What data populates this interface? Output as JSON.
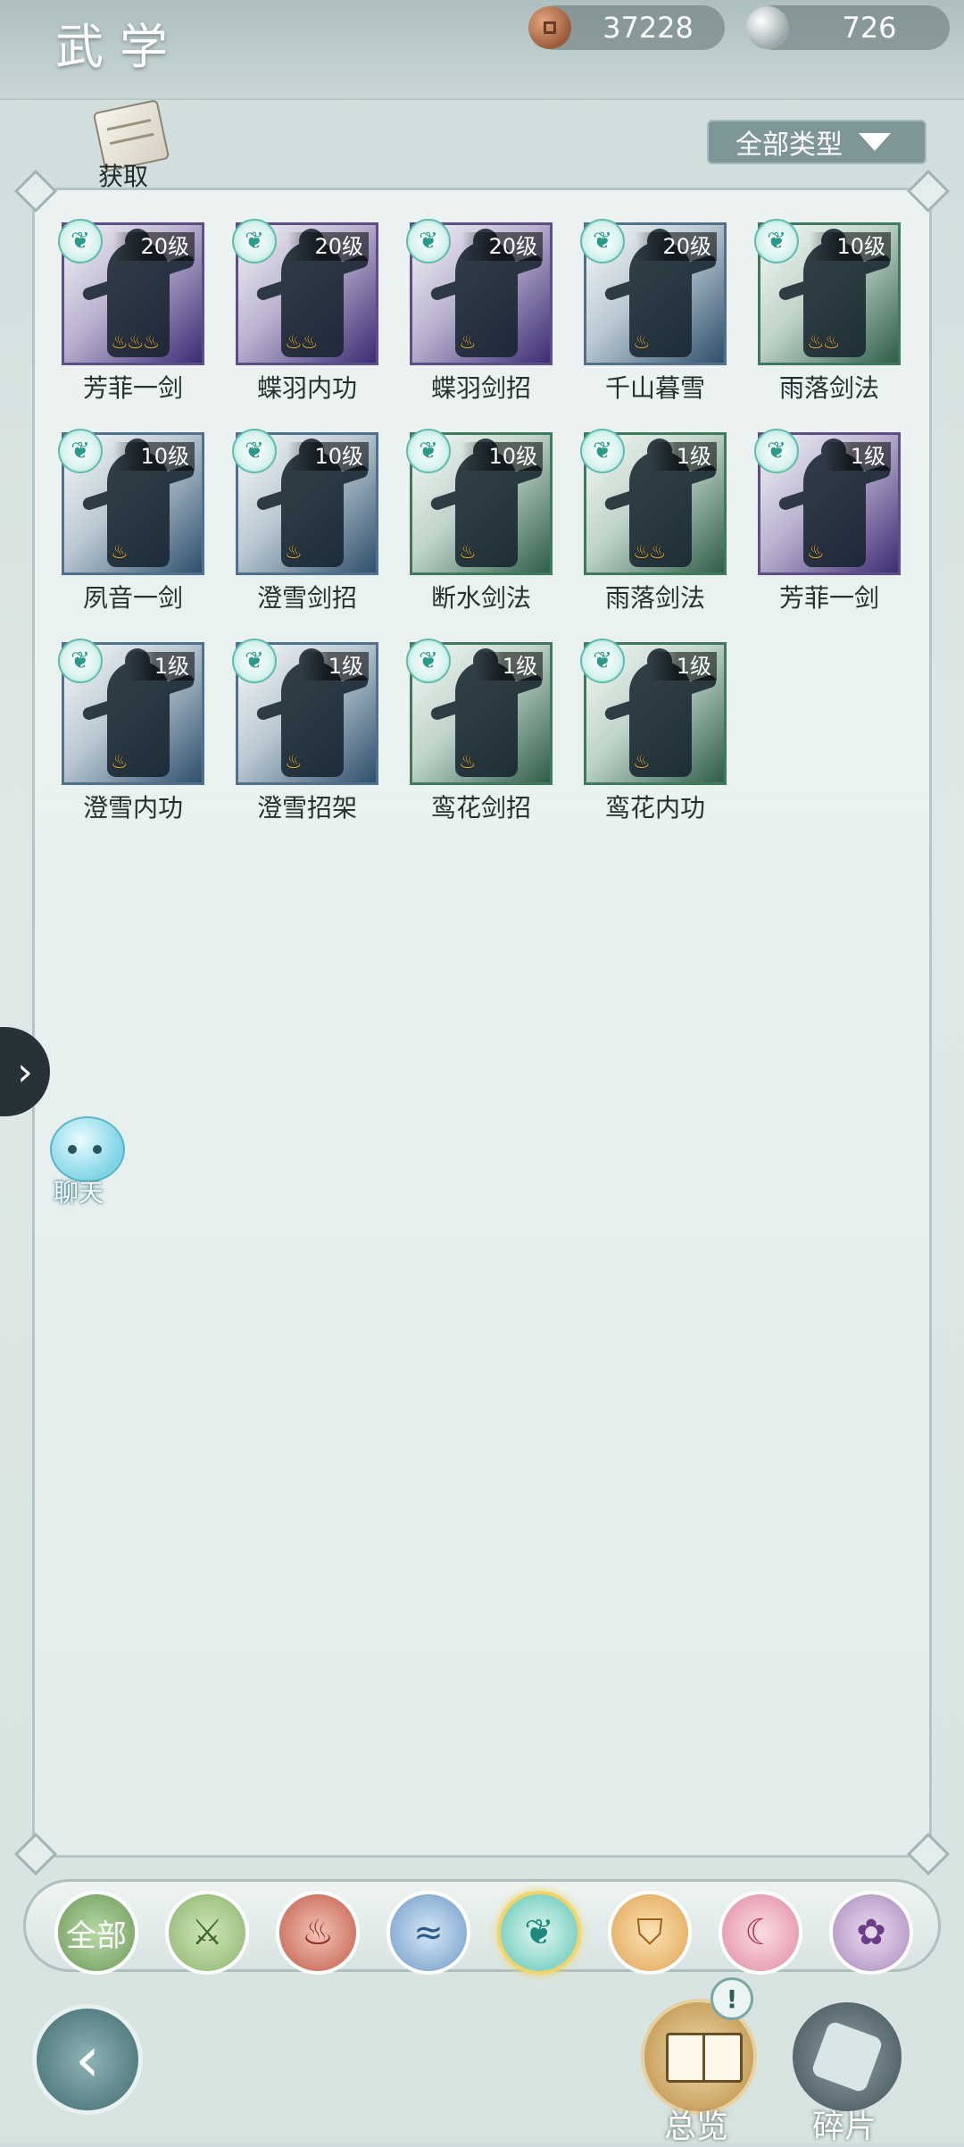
{
  "header": {
    "title": "武学",
    "coins": "37228",
    "silver": "726"
  },
  "toolbar": {
    "obtain_label": "获取",
    "type_filter": "全部类型"
  },
  "skills": [
    {
      "name": "芳菲一剑",
      "level": "20级",
      "theme": "purple",
      "stars": 3
    },
    {
      "name": "蝶羽内功",
      "level": "20级",
      "theme": "purple",
      "stars": 2
    },
    {
      "name": "蝶羽剑招",
      "level": "20级",
      "theme": "purple",
      "stars": 1
    },
    {
      "name": "千山暮雪",
      "level": "20级",
      "theme": "blue",
      "stars": 1
    },
    {
      "name": "雨落剑法",
      "level": "10级",
      "theme": "green",
      "stars": 2
    },
    {
      "name": "夙音一剑",
      "level": "10级",
      "theme": "blue",
      "stars": 1
    },
    {
      "name": "澄雪剑招",
      "level": "10级",
      "theme": "blue",
      "stars": 1
    },
    {
      "name": "断水剑法",
      "level": "10级",
      "theme": "green",
      "stars": 1
    },
    {
      "name": "雨落剑法",
      "level": "1级",
      "theme": "green",
      "stars": 2
    },
    {
      "name": "芳菲一剑",
      "level": "1级",
      "theme": "purple",
      "stars": 1
    },
    {
      "name": "澄雪内功",
      "level": "1级",
      "theme": "blue",
      "stars": 1
    },
    {
      "name": "澄雪招架",
      "level": "1级",
      "theme": "blue",
      "stars": 1
    },
    {
      "name": "鸾花剑招",
      "level": "1级",
      "theme": "green",
      "stars": 1
    },
    {
      "name": "鸾花内功",
      "level": "1级",
      "theme": "green",
      "stars": 1
    }
  ],
  "side": {
    "handle_glyph": "›",
    "chat_label": "聊天"
  },
  "sect_bar": {
    "all_label": "全部",
    "selected_index": 4,
    "icons": [
      "all-sect-icon",
      "sword-sect-icon",
      "flame-sect-icon",
      "wave-sect-icon",
      "butterfly-sect-icon",
      "shield-sect-icon",
      "moon-sect-icon",
      "rose-sect-icon"
    ]
  },
  "bottom": {
    "overview_label": "总览",
    "fragment_label": "碎片",
    "alert_glyph": "!"
  }
}
